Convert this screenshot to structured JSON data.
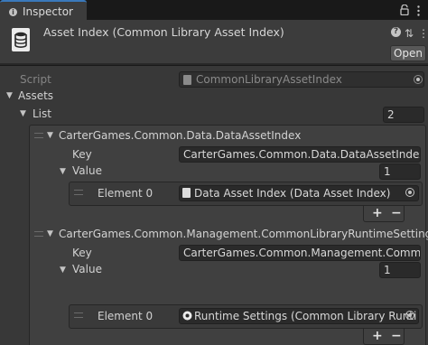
{
  "tab": {
    "label": "Inspector"
  },
  "header": {
    "title": "Asset Index (Common Library Asset Index)",
    "open_label": "Open",
    "help_glyph": "?",
    "settings_glyph": "⇅",
    "menu_glyph": "⋮"
  },
  "script_row": {
    "label": "Script",
    "value": "CommonLibraryAssetIndex"
  },
  "assets": {
    "label": "Assets"
  },
  "list": {
    "label": "List",
    "size": "2"
  },
  "entries": [
    {
      "title": "CarterGames.Common.Data.DataAssetIndex",
      "key_label": "Key",
      "key_value": "CarterGames.Common.Data.DataAssetIndex",
      "value_label": "Value",
      "value_size": "1",
      "element_label": "Element 0",
      "element_value": "Data Asset Index (Data Asset Index)"
    },
    {
      "title": "CarterGames.Common.Management.CommonLibraryRuntimeSettings",
      "key_label": "Key",
      "key_value": "CarterGames.Common.Management.CommonL",
      "value_label": "Value",
      "value_size": "1",
      "element_label": "Element 0",
      "element_value": "Runtime Settings (Common Library Runti"
    }
  ],
  "buttons": {
    "plus": "+",
    "minus": "−"
  },
  "colors": {
    "accent": "#3a79bb",
    "background": "#383838",
    "field": "#2a2a2a"
  }
}
